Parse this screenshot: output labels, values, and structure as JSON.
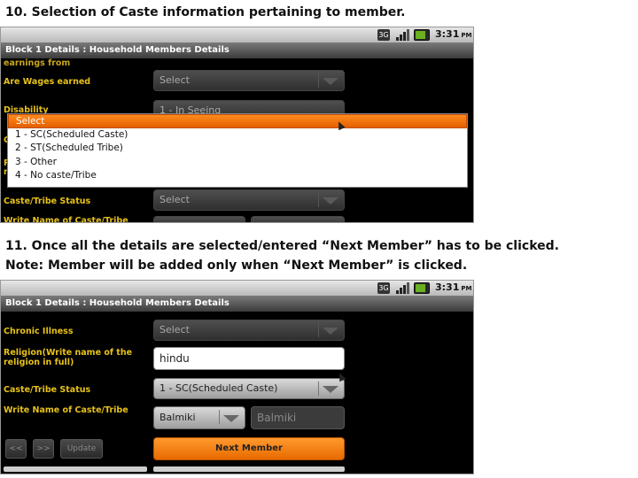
{
  "captions": {
    "step10": "10. Selection of Caste information pertaining to member.",
    "step11_line1": "11. Once all the details are selected/entered “Next Member” has to be clicked.",
    "step11_line2": "Note: Member will be added only when “Next Member” is clicked."
  },
  "statusbar": {
    "network": "3G",
    "time": "3:31",
    "ampm": "PM"
  },
  "screen1": {
    "title": "Block 1 Details : Household Members Details",
    "label_earnings_partial": "earnings from",
    "label_wages": "Are Wages earned",
    "wages_value": "Select",
    "label_disability": "Disability",
    "disability_value": "1 - In Seeing",
    "label_clipped_ch": "Ch",
    "label_clipped_re1": "Re",
    "label_clipped_re2": "re",
    "label_caste_status": "Caste/Tribe Status",
    "caste_status_value": "Select",
    "label_write_name_partial": "Write Name of Caste/Tribe",
    "dropdown_options": [
      "Select",
      "1 - SC(Scheduled Caste)",
      "2 - ST(Scheduled Tribe)",
      "3 - Other",
      "4 - No caste/Tribe"
    ],
    "dropdown_selected_index": 0
  },
  "screen2": {
    "title": "Block 1 Details : Household Members Details",
    "label_chronic": "Chronic Illness",
    "chronic_value": "Select",
    "label_religion_line1": "Religion(Write name of the",
    "label_religion_line2": "religion in full)",
    "religion_value": "hindu",
    "label_caste_status": "Caste/Tribe Status",
    "caste_status_value": "1 - SC(Scheduled Caste)",
    "label_write_name": "Write Name of Caste/Tribe",
    "caste_name_select_value": "Balmiki",
    "caste_name_text_value": "Balmiki",
    "btn_prev": "<<",
    "btn_next": ">>",
    "btn_update": "Update",
    "btn_next_member": "Next Member"
  },
  "colors": {
    "label_yellow": "#e7c21a",
    "accent_orange": "#f07a0a",
    "screen_bg": "#000000"
  }
}
